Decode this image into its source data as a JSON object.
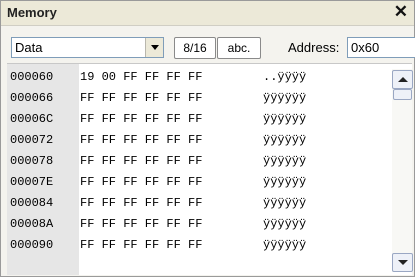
{
  "window": {
    "title": "Memory",
    "close_glyph": "✕"
  },
  "toolbar": {
    "memory_type": "Data",
    "btn_width": "8/16",
    "btn_ascii": "abc.",
    "address_label": "Address:",
    "address_value": "0x60"
  },
  "rows": [
    {
      "addr": "000060",
      "hex": "19 00 FF FF FF FF",
      "text": "..ÿÿÿÿ"
    },
    {
      "addr": "000066",
      "hex": "FF FF FF FF FF FF",
      "text": "ÿÿÿÿÿÿ"
    },
    {
      "addr": "00006C",
      "hex": "FF FF FF FF FF FF",
      "text": "ÿÿÿÿÿÿ"
    },
    {
      "addr": "000072",
      "hex": "FF FF FF FF FF FF",
      "text": "ÿÿÿÿÿÿ"
    },
    {
      "addr": "000078",
      "hex": "FF FF FF FF FF FF",
      "text": "ÿÿÿÿÿÿ"
    },
    {
      "addr": "00007E",
      "hex": "FF FF FF FF FF FF",
      "text": "ÿÿÿÿÿÿ"
    },
    {
      "addr": "000084",
      "hex": "FF FF FF FF FF FF",
      "text": "ÿÿÿÿÿÿ"
    },
    {
      "addr": "00008A",
      "hex": "FF FF FF FF FF FF",
      "text": "ÿÿÿÿÿÿ"
    },
    {
      "addr": "000090",
      "hex": "FF FF FF FF FF FF",
      "text": "ÿÿÿÿÿÿ"
    }
  ],
  "colors": {
    "address_column_bg": "#e6e6e6",
    "window_bg": "#f4f3ee"
  }
}
